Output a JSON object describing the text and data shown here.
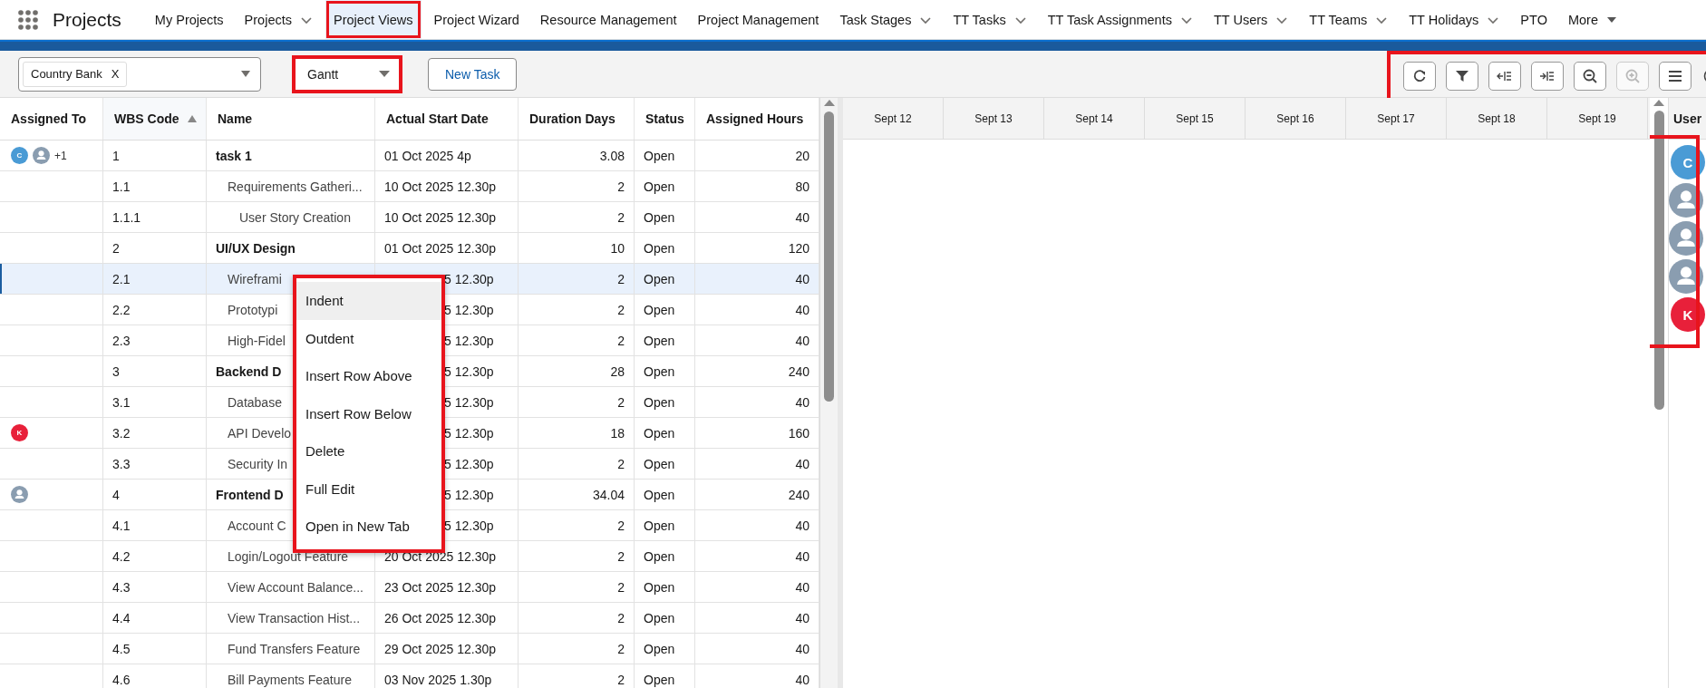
{
  "app": {
    "name": "Projects"
  },
  "nav": [
    {
      "label": "My Projects",
      "selected": false,
      "dropdown": false,
      "highlighted": false
    },
    {
      "label": "Projects",
      "selected": false,
      "dropdown": true,
      "highlighted": false
    },
    {
      "label": "Project Views",
      "selected": true,
      "dropdown": false,
      "highlighted": true
    },
    {
      "label": "Project Wizard",
      "selected": false,
      "dropdown": false,
      "highlighted": false
    },
    {
      "label": "Resource Management",
      "selected": false,
      "dropdown": false,
      "highlighted": false
    },
    {
      "label": "Project Management",
      "selected": false,
      "dropdown": false,
      "highlighted": false
    },
    {
      "label": "Task Stages",
      "selected": false,
      "dropdown": true,
      "highlighted": false
    },
    {
      "label": "TT Tasks",
      "selected": false,
      "dropdown": true,
      "highlighted": false
    },
    {
      "label": "TT Task Assignments",
      "selected": false,
      "dropdown": true,
      "highlighted": false
    },
    {
      "label": "TT Users",
      "selected": false,
      "dropdown": true,
      "highlighted": false
    },
    {
      "label": "TT Teams",
      "selected": false,
      "dropdown": true,
      "highlighted": false
    },
    {
      "label": "TT Holidays",
      "selected": false,
      "dropdown": true,
      "highlighted": false
    },
    {
      "label": "PTO",
      "selected": false,
      "dropdown": false,
      "highlighted": false
    },
    {
      "label": "More",
      "selected": false,
      "dropdown": true,
      "highlighted": false
    }
  ],
  "toolbar": {
    "project_filter": {
      "chip": "Country Bank",
      "remove": "X"
    },
    "view_select": {
      "value": "Gantt",
      "highlighted": true
    },
    "new_task": "New Task",
    "icons_highlighted": true,
    "icon_buttons": [
      {
        "kind": "refresh",
        "disabled": false
      },
      {
        "kind": "filter",
        "disabled": false
      },
      {
        "kind": "outdent",
        "disabled": false
      },
      {
        "kind": "indent",
        "disabled": false
      },
      {
        "kind": "zoom-out",
        "disabled": false
      },
      {
        "kind": "zoom-in",
        "disabled": true
      },
      {
        "kind": "menu",
        "disabled": false
      },
      {
        "kind": "info",
        "disabled": false
      }
    ]
  },
  "table": {
    "columns": [
      {
        "label": "Assigned To",
        "sorted": false
      },
      {
        "label": "WBS Code",
        "sorted": true
      },
      {
        "label": "Name",
        "sorted": false
      },
      {
        "label": "Actual Start Date",
        "sorted": false
      },
      {
        "label": "Duration Days",
        "sorted": false
      },
      {
        "label": "Status",
        "sorted": false
      },
      {
        "label": "Assigned Hours",
        "sorted": false
      }
    ],
    "rows": [
      {
        "wbs": "1",
        "name": "task 1",
        "start": "01 Oct 2025 4p",
        "duration": "3.08",
        "status": "Open",
        "hours": "20",
        "selected": false,
        "covered": false,
        "assignees": [
          {
            "kind": "initial",
            "initial": "C",
            "color": "#4a9bd5"
          },
          {
            "kind": "person",
            "color": "#8a9db0"
          },
          {
            "kind": "more",
            "label": "+1"
          }
        ],
        "children": [
          {
            "wbs": "1.1",
            "name": "Requirements Gatheri...",
            "start": "10 Oct 2025 12.30p",
            "duration": "2",
            "status": "Open",
            "hours": "80",
            "selected": false,
            "covered": false,
            "children": [
              {
                "wbs": "1.1.1",
                "name": "User Story Creation",
                "start": "10 Oct 2025 12.30p",
                "duration": "2",
                "status": "Open",
                "hours": "40",
                "selected": false,
                "covered": false
              }
            ]
          }
        ]
      },
      {
        "wbs": "2",
        "name": "UI/UX Design",
        "start": "01 Oct 2025 12.30p",
        "duration": "10",
        "status": "Open",
        "hours": "120",
        "selected": false,
        "covered": false,
        "children": [
          {
            "wbs": "2.1",
            "name": "Wireframi",
            "start": "5 12.30p",
            "duration": "2",
            "status": "Open",
            "hours": "40",
            "selected": true,
            "covered": true
          },
          {
            "wbs": "2.2",
            "name": "Prototypi",
            "start": "5 12.30p",
            "duration": "2",
            "status": "Open",
            "hours": "40",
            "selected": false,
            "covered": true
          },
          {
            "wbs": "2.3",
            "name": "High-Fidel",
            "start": "5 12.30p",
            "duration": "2",
            "status": "Open",
            "hours": "40",
            "selected": false,
            "covered": true
          }
        ]
      },
      {
        "wbs": "3",
        "name": "Backend D",
        "start": "5 12.30p",
        "duration": "28",
        "status": "Open",
        "hours": "240",
        "selected": false,
        "covered": true,
        "children": [
          {
            "wbs": "3.1",
            "name": "Database",
            "start": "5 12.30p",
            "duration": "2",
            "status": "Open",
            "hours": "40",
            "selected": false,
            "covered": true
          },
          {
            "wbs": "3.2",
            "name": "API Develo",
            "start": "5 12.30p",
            "duration": "18",
            "status": "Open",
            "hours": "160",
            "selected": false,
            "covered": true,
            "assignees": [
              {
                "kind": "initial",
                "initial": "K",
                "color": "#e8203a"
              }
            ]
          },
          {
            "wbs": "3.3",
            "name": "Security In",
            "start": "5 12.30p",
            "duration": "2",
            "status": "Open",
            "hours": "40",
            "selected": false,
            "covered": true
          }
        ]
      },
      {
        "wbs": "4",
        "name": "Frontend D",
        "start": "5 12.30p",
        "duration": "34.04",
        "status": "Open",
        "hours": "240",
        "selected": false,
        "covered": true,
        "assignees": [
          {
            "kind": "person",
            "color": "#8a9db0"
          }
        ],
        "children": [
          {
            "wbs": "4.1",
            "name": "Account C",
            "start": "5 12.30p",
            "duration": "2",
            "status": "Open",
            "hours": "40",
            "selected": false,
            "covered": true
          },
          {
            "wbs": "4.2",
            "name": "Login/Logout Feature",
            "start": "20 Oct 2025 12.30p",
            "duration": "2",
            "status": "Open",
            "hours": "40",
            "selected": false,
            "covered": false
          },
          {
            "wbs": "4.3",
            "name": "View Account Balance...",
            "start": "23 Oct 2025 12.30p",
            "duration": "2",
            "status": "Open",
            "hours": "40",
            "selected": false,
            "covered": false
          },
          {
            "wbs": "4.4",
            "name": "View Transaction Hist...",
            "start": "26 Oct 2025 12.30p",
            "duration": "2",
            "status": "Open",
            "hours": "40",
            "selected": false,
            "covered": false
          },
          {
            "wbs": "4.5",
            "name": "Fund Transfers Feature",
            "start": "29 Oct 2025 12.30p",
            "duration": "2",
            "status": "Open",
            "hours": "40",
            "selected": false,
            "covered": false
          },
          {
            "wbs": "4.6",
            "name": "Bill Payments Feature",
            "start": "03 Nov 2025 1.30p",
            "duration": "2",
            "status": "Open",
            "hours": "40",
            "selected": false,
            "covered": false
          }
        ]
      }
    ]
  },
  "gantt": {
    "dates": [
      "Sept 12",
      "Sept 13",
      "Sept 14",
      "Sept 15",
      "Sept 16",
      "Sept 17",
      "Sept 18",
      "Sept 19"
    ]
  },
  "users": {
    "header": "User",
    "highlighted": true,
    "avatars": [
      {
        "kind": "initial",
        "initial": "C",
        "color": "#4a9bd5"
      },
      {
        "kind": "person",
        "color": "#8a9db0"
      },
      {
        "kind": "person",
        "color": "#8a9db0"
      },
      {
        "kind": "person",
        "color": "#8a9db0"
      },
      {
        "kind": "initial",
        "initial": "K",
        "color": "#e8203a"
      }
    ]
  },
  "context_menu": {
    "highlighted": true,
    "items": [
      {
        "label": "Indent",
        "selected": true
      },
      {
        "label": "Outdent",
        "selected": false
      },
      {
        "label": "Insert Row Above",
        "selected": false
      },
      {
        "label": "Insert Row Below",
        "selected": false
      },
      {
        "label": "Delete",
        "selected": false
      },
      {
        "label": "Full Edit",
        "selected": false
      },
      {
        "label": "Open in New Tab",
        "selected": false
      }
    ]
  }
}
